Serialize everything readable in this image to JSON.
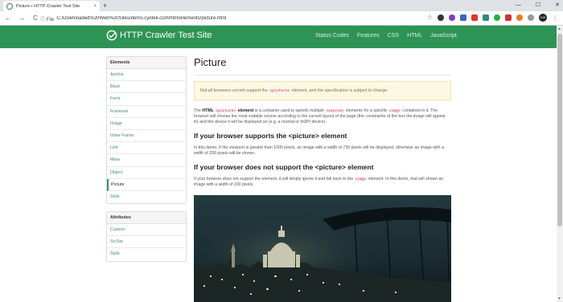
{
  "browser": {
    "tab_title": "Picture • HTTP Crawler Test Site",
    "tab_close": "×",
    "new_tab": "+",
    "window_controls": [
      "—",
      "☐",
      "✕"
    ],
    "nav": {
      "back": "←",
      "forward": "→",
      "reload": "C"
    },
    "file_label": "ⓘ  File",
    "url": "C:/Downloaded%20Web%20Sites/demo.cyotek.com/html/elements/picture.html",
    "avatar_text": "CW"
  },
  "header": {
    "brand": "HTTP Crawler Test Site",
    "nav": [
      "Status Codes",
      "Features",
      "CSS",
      "HTML",
      "JavaScript"
    ]
  },
  "sidebar": {
    "elements_heading": "Elements",
    "elements": [
      "Anchor",
      "Base",
      "Form",
      "Frameset",
      "Image",
      "Inline Frame",
      "Link",
      "Meta",
      "Object",
      "Picture",
      "Style"
    ],
    "active_index": 9,
    "attributes_heading": "Attributes",
    "attributes": [
      "Custom",
      "SrcSet",
      "Style"
    ]
  },
  "main": {
    "title": "Picture",
    "alert": {
      "before": "Not all browsers current support the ",
      "code": "<picture>",
      "after": " element, and the specification is subject to change."
    },
    "intro": {
      "p1": "The ",
      "b1": "HTML",
      "c1": "<picture>",
      "b2": "element",
      "p2": " is a container used to specify multiple ",
      "c2": "<source>",
      "p3": " elements for a specific ",
      "c3": "<img>",
      "p4": " contained in it. The browser will choose the most suitable source according to the current layout of the page (the constraints of the box the image will appear in) and the device it will be displayed on (e.g. a normal or hiDPI device)."
    },
    "h_support": "If your browser supports the <picture> element",
    "p_support": "In this demo, if the viewport is greater than 1000 pixels, an image with a width of 730 pixels will be displayed, otherwise an image with a width of 330 pixels will be shown.",
    "h_nosupport": "If your browser does not support the <picture> element",
    "p_nosupport": {
      "before": "If your browser does not support the element, it will simply ignore it and fall back to the ",
      "code": "<img>",
      "after": " element. In this demo, that will shown an image with a width of 200 pixels."
    }
  },
  "colors": {
    "brand": "#2e9456",
    "link": "#3d8e63",
    "alert_bg": "#fcf8e3",
    "alert_text": "#8a6d3b"
  }
}
